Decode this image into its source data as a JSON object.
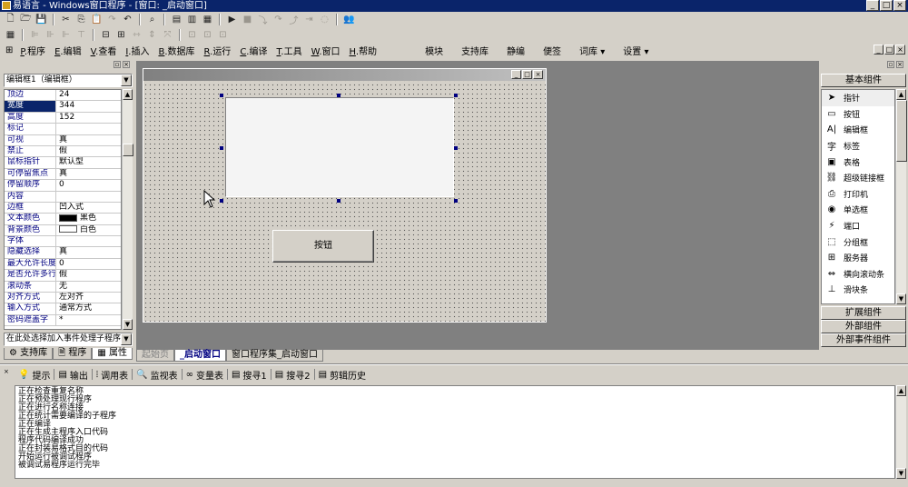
{
  "window": {
    "title": "易语言 - Windows窗口程序 - [窗口: _启动窗口]",
    "min": "_",
    "max": "□",
    "close": "×"
  },
  "menu": {
    "items": [
      {
        "key": "P",
        "label": "程序"
      },
      {
        "key": "E",
        "label": "编辑"
      },
      {
        "key": "V",
        "label": "查看"
      },
      {
        "key": "I",
        "label": "插入"
      },
      {
        "key": "B",
        "label": "数据库"
      },
      {
        "key": "R",
        "label": "运行"
      },
      {
        "key": "C",
        "label": "编译"
      },
      {
        "key": "T",
        "label": "工具"
      },
      {
        "key": "W",
        "label": "窗口"
      },
      {
        "key": "H",
        "label": "帮助"
      }
    ],
    "extras": [
      "模块",
      "支持库",
      "静编",
      "便签",
      "词库 ▾",
      "设置 ▾"
    ]
  },
  "left": {
    "combo": "编辑框1（编辑框）",
    "props": [
      {
        "k": "顶边",
        "v": "24"
      },
      {
        "k": "宽度",
        "v": "344",
        "sel": true
      },
      {
        "k": "高度",
        "v": "152"
      },
      {
        "k": "标记",
        "v": ""
      },
      {
        "k": "可视",
        "v": "真"
      },
      {
        "k": "禁止",
        "v": "假"
      },
      {
        "k": "鼠标指针",
        "v": "默认型"
      },
      {
        "k": "可停留焦点",
        "v": "真"
      },
      {
        "k": "  停留顺序",
        "v": "0"
      },
      {
        "k": "内容",
        "v": ""
      },
      {
        "k": "边框",
        "v": "凹入式"
      },
      {
        "k": "文本颜色",
        "v": "黑色",
        "sw": "#000000"
      },
      {
        "k": "背景颜色",
        "v": "白色",
        "sw": "#ffffff"
      },
      {
        "k": "字体",
        "v": ""
      },
      {
        "k": "隐藏选择",
        "v": "真"
      },
      {
        "k": "最大允许长度",
        "v": "0"
      },
      {
        "k": "是否允许多行",
        "v": "假"
      },
      {
        "k": "滚动条",
        "v": "无"
      },
      {
        "k": "对齐方式",
        "v": "左对齐"
      },
      {
        "k": "输入方式",
        "v": "通常方式"
      },
      {
        "k": "  密码遮盖字",
        "v": "*"
      }
    ],
    "event_combo": "在此处选择加入事件处理子程序",
    "tabs": [
      "支持库",
      "程序",
      "属性"
    ]
  },
  "designer": {
    "button_label": "按钮",
    "tabs": [
      "起始页",
      "_启动窗口",
      "窗口程序集_启动窗口"
    ]
  },
  "right": {
    "header": "基本组件",
    "components": [
      {
        "icon": "➤",
        "label": "指针",
        "name": "pointer-icon"
      },
      {
        "icon": "▭",
        "label": "按钮",
        "name": "button-icon"
      },
      {
        "icon": "A|",
        "label": "编辑框",
        "name": "editbox-icon"
      },
      {
        "icon": "字",
        "label": "标签",
        "name": "label-icon"
      },
      {
        "icon": "▣",
        "label": "表格",
        "name": "table-icon"
      },
      {
        "icon": "⛓",
        "label": "超级链接框",
        "name": "hyperlink-icon"
      },
      {
        "icon": "⎙",
        "label": "打印机",
        "name": "printer-icon"
      },
      {
        "icon": "◉",
        "label": "单选框",
        "name": "radio-icon"
      },
      {
        "icon": "⚡",
        "label": "端口",
        "name": "port-icon"
      },
      {
        "icon": "⬚",
        "label": "分组框",
        "name": "groupbox-icon"
      },
      {
        "icon": "⊞",
        "label": "服务器",
        "name": "server-icon"
      },
      {
        "icon": "⇔",
        "label": "横向滚动条",
        "name": "hscroll-icon"
      },
      {
        "icon": "⊥",
        "label": "滑块条",
        "name": "slider-icon"
      }
    ],
    "groups": [
      "扩展组件",
      "外部组件",
      "外部事件组件"
    ]
  },
  "output": {
    "tabs": [
      {
        "icon": "💡",
        "label": "提示",
        "name": "hint-icon"
      },
      {
        "icon": "▤",
        "label": "输出",
        "name": "output-icon"
      },
      {
        "icon": "⦙",
        "label": "调用表",
        "name": "callstack-icon"
      },
      {
        "icon": "🔍",
        "label": "监视表",
        "name": "watch-icon"
      },
      {
        "icon": "∞",
        "label": "变量表",
        "name": "vars-icon"
      },
      {
        "icon": "▤",
        "label": "搜寻1",
        "name": "search1-icon"
      },
      {
        "icon": "▤",
        "label": "搜寻2",
        "name": "search2-icon"
      },
      {
        "icon": "▤",
        "label": "剪辑历史",
        "name": "cliphistory-icon"
      }
    ],
    "lines": [
      "正在检查重复名称",
      "正在预处理现行程序",
      "正在进行名称连接",
      "正在统计需要编译的子程序",
      "正在编译",
      "正在生成主程序入口代码",
      "程序代码编译成功",
      "正在封装易格式目的代码",
      "开始运行被调试程序",
      "被调试易程序运行完毕"
    ]
  }
}
